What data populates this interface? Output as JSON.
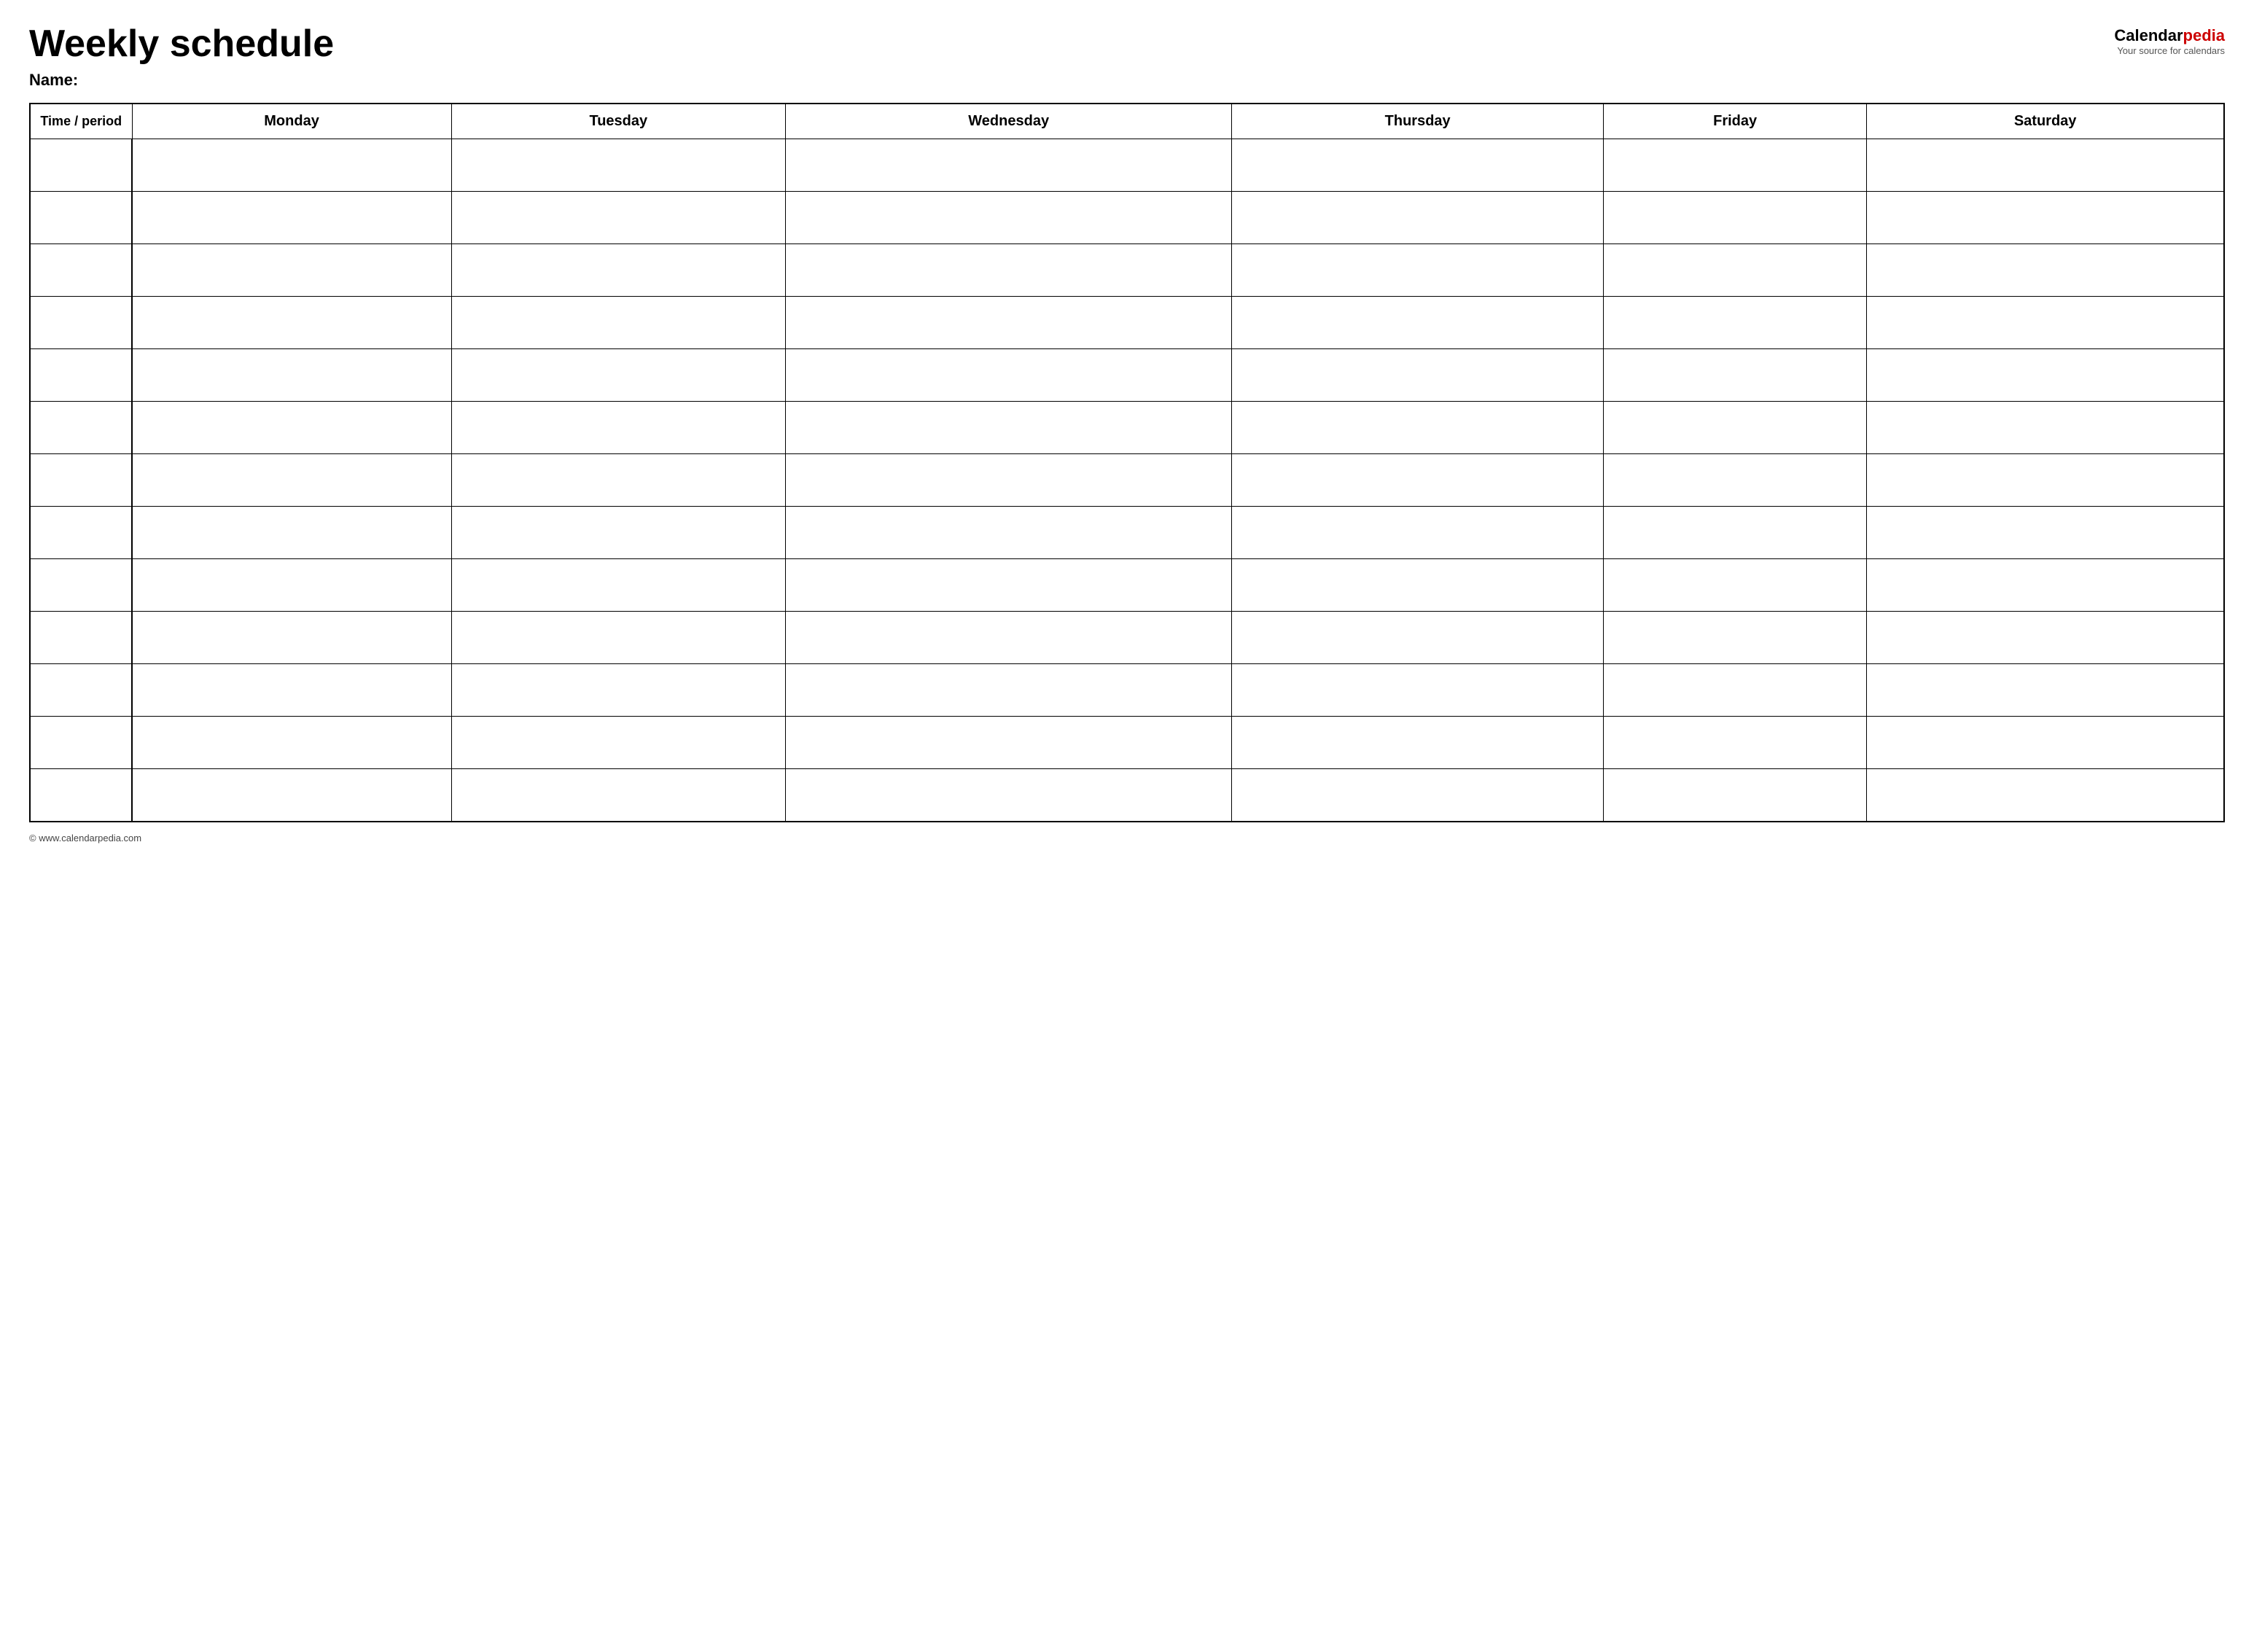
{
  "header": {
    "title": "Weekly schedule",
    "brand": {
      "calendar": "Calendar",
      "pedia": "pedia",
      "tagline": "Your source for calendars"
    },
    "name_label": "Name:"
  },
  "table": {
    "columns": [
      {
        "id": "time",
        "label": "Time / period"
      },
      {
        "id": "monday",
        "label": "Monday"
      },
      {
        "id": "tuesday",
        "label": "Tuesday"
      },
      {
        "id": "wednesday",
        "label": "Wednesday"
      },
      {
        "id": "thursday",
        "label": "Thursday"
      },
      {
        "id": "friday",
        "label": "Friday"
      },
      {
        "id": "saturday",
        "label": "Saturday"
      }
    ],
    "row_count": 13
  },
  "footer": {
    "text": "© www.calendarpedia.com"
  }
}
